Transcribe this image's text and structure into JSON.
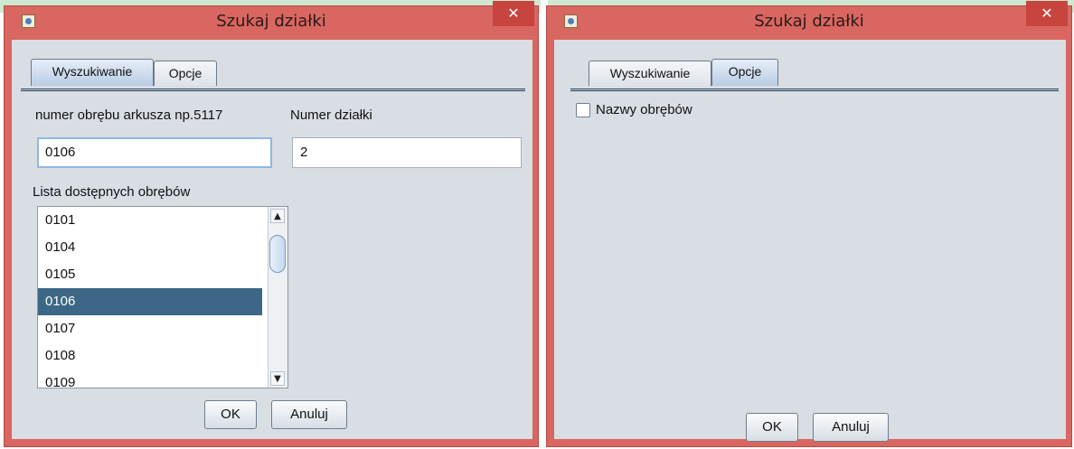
{
  "dialogs": [
    {
      "title": "Szukaj działki",
      "close_label": "✕",
      "tabs": [
        {
          "label": "Wyszukiwanie",
          "active": true
        },
        {
          "label": "Opcje",
          "active": false
        }
      ],
      "sheet_label": "numer obrębu arkusza np.5117",
      "sheet_value": "0106",
      "parcel_label": "Numer działki",
      "parcel_value": "2",
      "list_label": "Lista dostępnych obrębów",
      "list_items": [
        "0101",
        "0104",
        "0105",
        "0106",
        "0107",
        "0108",
        "0109"
      ],
      "selected_item": "0106",
      "scroll_up": "▲",
      "scroll_down": "▼",
      "ok_label": "OK",
      "cancel_label": "Anuluj"
    },
    {
      "title": "Szukaj działki",
      "close_label": "✕",
      "tabs": [
        {
          "label": "Wyszukiwanie",
          "active": false
        },
        {
          "label": "Opcje",
          "active": true
        }
      ],
      "checkbox_label": "Nazwy obrębów",
      "checkbox_checked": false,
      "ok_label": "OK",
      "cancel_label": "Anuluj"
    }
  ],
  "colors": {
    "frame": "#d96660",
    "client": "#d9dde4",
    "selection": "#3c6786",
    "close_button": "#c7453e"
  }
}
